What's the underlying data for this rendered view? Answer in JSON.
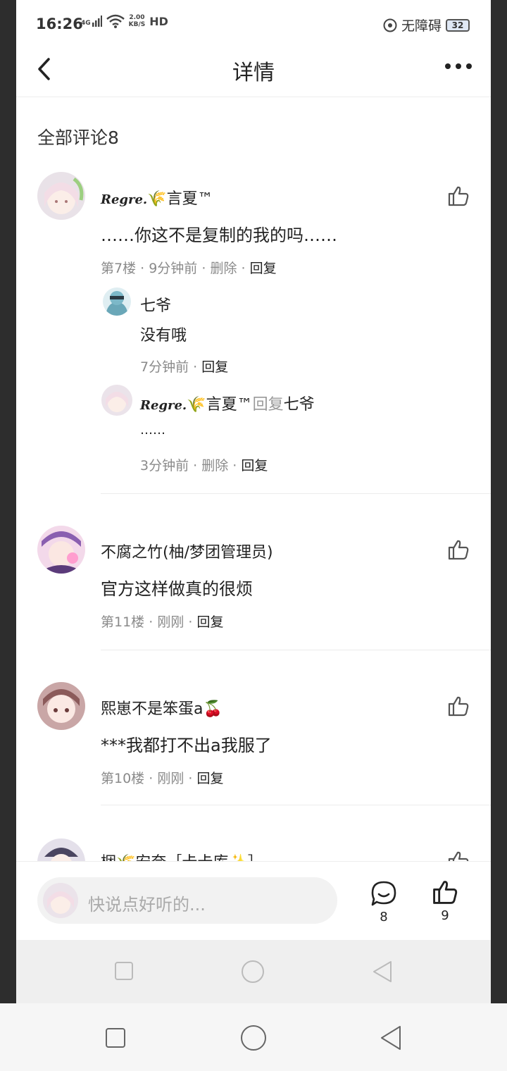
{
  "status_bar": {
    "time": "16:26",
    "network": "4G",
    "speed_top": "2.00",
    "speed_bottom": "KB/S",
    "hd": "HD",
    "accessibility": "无障碍",
    "battery": "32"
  },
  "header": {
    "title": "详情"
  },
  "comments_section": {
    "title": "全部评论8",
    "comments": [
      {
        "user_sig": "Regre.",
        "user_name": "🌾言夏™",
        "text": "……你这不是复制的我的吗……",
        "floor": "第7楼",
        "time": "9分钟前",
        "delete": "删除",
        "reply": "回复",
        "replies": [
          {
            "user_name": "七爷",
            "text": "没有哦",
            "time": "7分钟前",
            "reply": "回复"
          },
          {
            "user_sig": "Regre.",
            "user_name": "🌾言夏™",
            "reply_word": "回复",
            "reply_to": "七爷",
            "text": "……",
            "time": "3分钟前",
            "delete": "删除",
            "reply": "回复"
          }
        ]
      },
      {
        "user_name": "不腐之竹(柚/梦团管理员)",
        "text": "官方这样做真的很烦",
        "floor": "第11楼",
        "time": "刚刚",
        "reply": "回复"
      },
      {
        "user_name": "熙崽不是笨蛋a🍒",
        "text": "***我都打不出a我服了",
        "floor": "第10楼",
        "time": "刚刚",
        "reply": "回复"
      },
      {
        "user_name": "梱🌾安奈［卡卡库✨］"
      }
    ]
  },
  "input_bar": {
    "placeholder": "快说点好听的...",
    "comment_count": "8",
    "like_count": "9"
  },
  "icons": {
    "back": "back-arrow-icon",
    "more": "more-dots-icon",
    "like": "thumbs-up-icon",
    "comment": "comment-bubble-icon"
  },
  "colors": {
    "background": "#ffffff",
    "meta_text": "#8a8a8a",
    "frame": "#2d2d2d"
  }
}
